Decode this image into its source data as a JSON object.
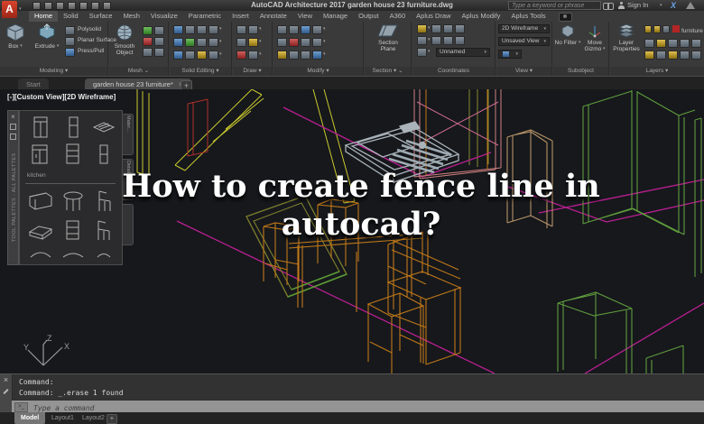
{
  "window": {
    "logo_letter": "A",
    "title": "AutoCAD Architecture 2017    garden house 23 furniture.dwg",
    "search_placeholder": "Type a keyword or phrase",
    "sign_in_label": "Sign In"
  },
  "ribbon": {
    "tabs": [
      "Home",
      "Solid",
      "Surface",
      "Mesh",
      "Visualize",
      "Parametric",
      "Insert",
      "Annotate",
      "View",
      "Manage",
      "Output",
      "A360",
      "Aplus Draw",
      "Aplus Modify",
      "Aplus Tools"
    ],
    "active_tab": "Home",
    "modeling": {
      "label": "Modeling",
      "box": "Box",
      "extrude": "Extrude",
      "polysolid": "Polysolid",
      "planar_surface": "Planar Surface",
      "press_pull": "Press/Pull"
    },
    "mesh": {
      "label": "Mesh",
      "smooth_object": "Smooth Object"
    },
    "solid_editing": {
      "label": "Solid Editing"
    },
    "draw": {
      "label": "Draw"
    },
    "modify": {
      "label": "Modify"
    },
    "section": {
      "label": "Section",
      "section_plane": "Section Plane"
    },
    "coordinates": {
      "label": "Coordinates",
      "ucs_value": "Unnamed"
    },
    "view": {
      "label": "View",
      "visual_style": "2D Wireframe",
      "named_view": "Unsaved View"
    },
    "subobject": {
      "label": "Subobject",
      "no_filter": "No Filter",
      "move_gizmo": "Move Gizmo"
    },
    "layers": {
      "label": "Layers",
      "layer_properties": "Layer Properties",
      "current_layer": "furniture",
      "layer_color": "#b42525"
    }
  },
  "file_tabs": {
    "start": "Start",
    "drawing": "garden house 23 furniture*"
  },
  "viewport": {
    "controls": "[-][Custom View][2D Wireframe]",
    "ucs_x": "X",
    "ucs_y": "Y",
    "ucs_z": "Z"
  },
  "overlay": {
    "title": "How to create fence line in autocad?"
  },
  "palette": {
    "strip_title": "TOOL PALETTES - ALL PALETTES",
    "group_label": "kitchen",
    "side_tabs": [
      "Mater...",
      "Detail..."
    ]
  },
  "command_line": {
    "history": [
      "Command:",
      "Command: _.erase 1 found"
    ],
    "placeholder": "Type a command"
  },
  "layout_tabs": {
    "model": "Model",
    "layout1": "Layout1",
    "layout2": "Layout2"
  },
  "icons": {
    "close": "×",
    "plus": "+",
    "caret": "▾",
    "minimize": "–",
    "prompt": ">_"
  },
  "colors": {
    "wire_yellow": "#c9c92e",
    "wire_magenta": "#bb1f92",
    "wire_orange": "#c07818",
    "wire_green": "#5f9c3c",
    "wire_gray": "#a9b3b9",
    "wire_tan": "#b59265",
    "wire_red": "#b03028",
    "wire_olive": "#8a8a2e",
    "layer_red": "#b42525"
  }
}
